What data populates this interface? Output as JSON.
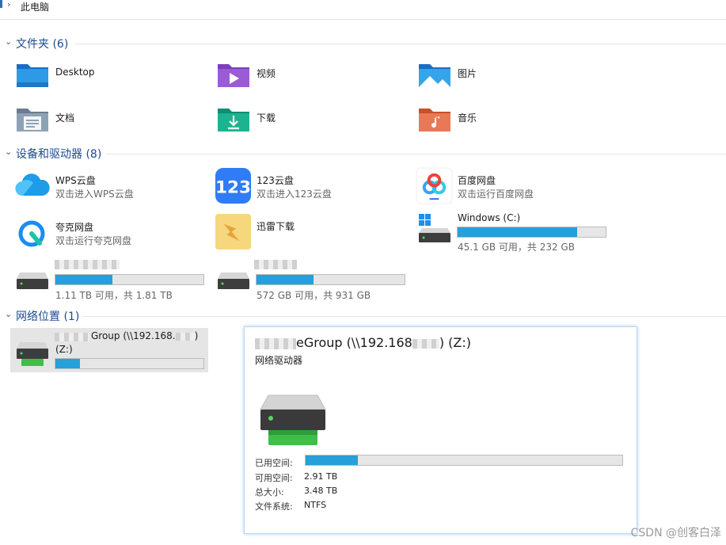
{
  "breadcrumb": {
    "location": "此电脑"
  },
  "sections": {
    "folders": "文件夹 (6)",
    "devices": "设备和驱动器 (8)",
    "network": "网络位置 (1)"
  },
  "folders": [
    {
      "name": "Desktop",
      "icon": "desktop-folder-icon"
    },
    {
      "name": "视频",
      "icon": "videos-folder-icon"
    },
    {
      "name": "图片",
      "icon": "pictures-folder-icon"
    },
    {
      "name": "文档",
      "icon": "documents-folder-icon"
    },
    {
      "name": "下载",
      "icon": "downloads-folder-icon"
    },
    {
      "name": "音乐",
      "icon": "music-folder-icon"
    }
  ],
  "devices": {
    "wps": {
      "name": "WPS云盘",
      "sub": "双击进入WPS云盘",
      "icon": "wps-cloud-icon"
    },
    "d123": {
      "name": "123云盘",
      "sub": "双击进入123云盘",
      "icon": "123-cloud-icon"
    },
    "baidu": {
      "name": "百度网盘",
      "sub": "双击运行百度网盘",
      "icon": "baidu-netdisk-icon"
    },
    "quark": {
      "name": "夸克网盘",
      "sub": "双击运行夸克网盘",
      "icon": "quark-netdisk-icon"
    },
    "xunlei": {
      "name": "迅雷下载",
      "icon": "xunlei-icon"
    },
    "windows": {
      "name": "Windows (C:)",
      "space": "45.1 GB 可用，共 232 GB",
      "used_fraction": 0.806
    },
    "drive1": {
      "space": "1.11 TB 可用，共 1.81 TB",
      "used_fraction": 0.387
    },
    "drive2": {
      "space": "572 GB 可用，共 931 GB",
      "used_fraction": 0.386
    }
  },
  "network": {
    "name_visible": "Group (\\\\192.168.",
    "name_suffix": ")",
    "letter": "(Z:)",
    "used_fraction": 0.164
  },
  "tooltip": {
    "title_visible": "eGroup (\\\\192.168",
    "title_suffix": ") (Z:)",
    "type": "网络驱动器",
    "used_label": "已用空间:",
    "free_label": "可用空间:",
    "free_value": "2.91 TB",
    "total_label": "总大小:",
    "total_value": "3.48 TB",
    "fs_label": "文件系统:",
    "fs_value": "NTFS",
    "used_fraction": 0.164
  },
  "watermark": "CSDN @创客白泽",
  "colors": {
    "bar_fill": "#26a0da",
    "section_title": "#1e4a8e",
    "selected_bg": "#e5e5e5"
  }
}
